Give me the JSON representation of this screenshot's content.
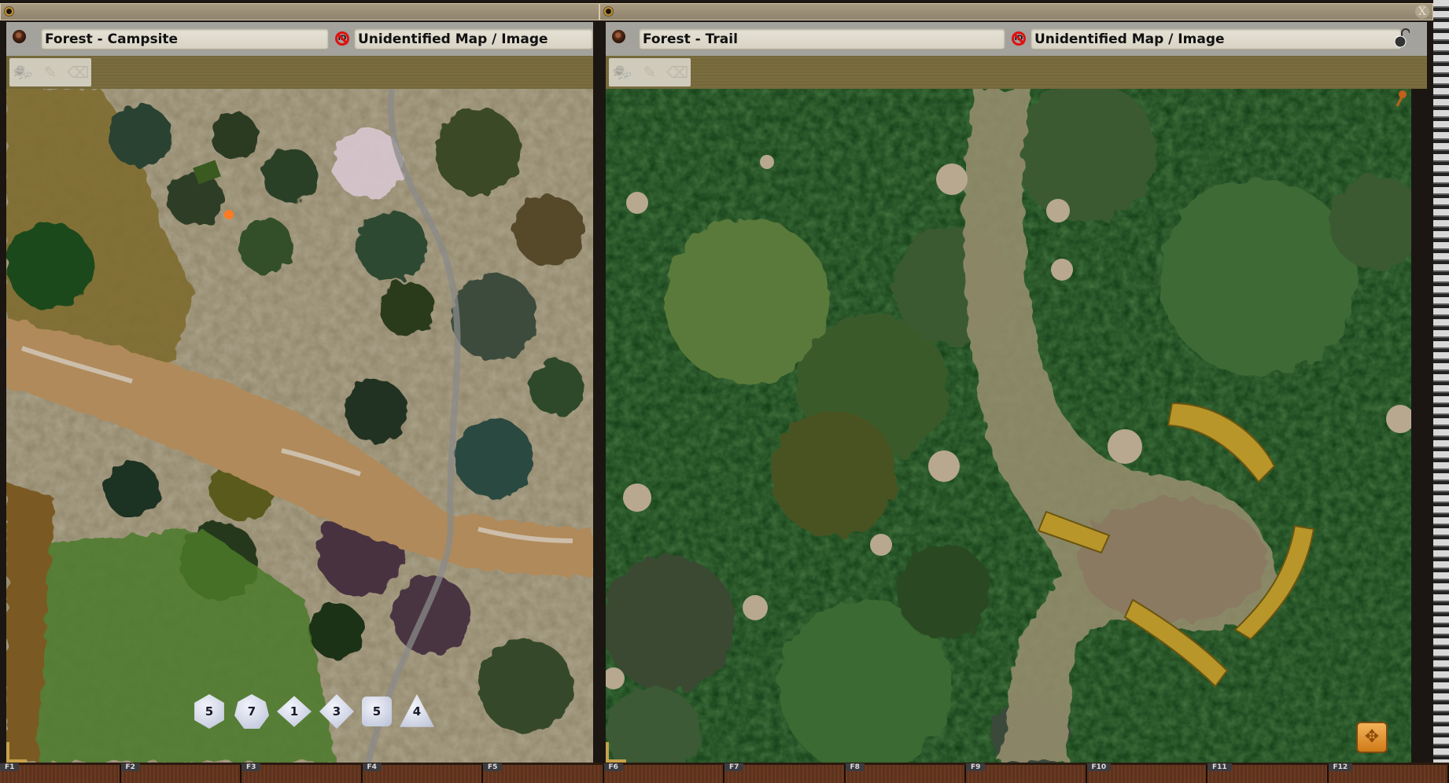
{
  "windows": [
    {
      "id": "left",
      "name": "Forest - Campsite",
      "type_label": "Unidentified Map / Image",
      "tools": [
        "mask-tool",
        "pencil-tool",
        "eraser-tool"
      ],
      "map_theme": "campsite"
    },
    {
      "id": "right",
      "name": "Forest - Trail",
      "type_label": "Unidentified Map / Image",
      "tools": [
        "mask-tool",
        "pencil-tool",
        "eraser-tool"
      ],
      "close_label": "X",
      "map_theme": "trail"
    }
  ],
  "dice": [
    {
      "type": "d20",
      "face": "5"
    },
    {
      "type": "d12",
      "face": "7"
    },
    {
      "type": "d10",
      "face": "1"
    },
    {
      "type": "d8",
      "face": "3"
    },
    {
      "type": "d6",
      "face": "5"
    },
    {
      "type": "d4",
      "face": "4"
    }
  ],
  "hotkeys": [
    "F1",
    "F2",
    "F3",
    "F4",
    "F5",
    "F6",
    "F7",
    "F8",
    "F9",
    "F10",
    "F11",
    "F12"
  ],
  "icons": {
    "tool_mask": "🎭",
    "tool_pencil": "✎",
    "tool_eraser": "⌫",
    "move": "✥"
  },
  "colors": {
    "header_bg": "#a3a29c",
    "toolbar_bg": "#7a6d3e",
    "id_badge": "#e01010",
    "move_button": "#e8962e",
    "campsite_ground": "#8f8468",
    "trail_ground": "#0f3a14",
    "dirt_path": "#b08a5a"
  }
}
